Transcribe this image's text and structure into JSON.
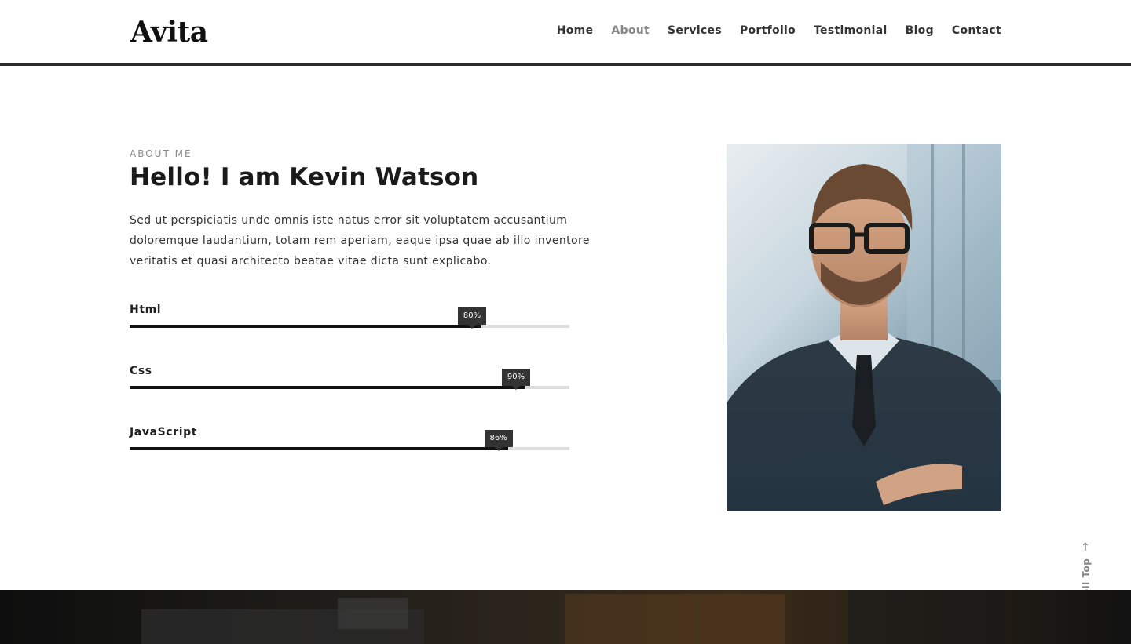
{
  "header": {
    "logo": "Avita",
    "nav": [
      {
        "label": "Home",
        "active": false
      },
      {
        "label": "About",
        "active": true
      },
      {
        "label": "Services",
        "active": false
      },
      {
        "label": "Portfolio",
        "active": false
      },
      {
        "label": "Testimonial",
        "active": false
      },
      {
        "label": "Blog",
        "active": false
      },
      {
        "label": "Contact",
        "active": false
      }
    ]
  },
  "about": {
    "eyebrow": "ABOUT ME",
    "title": "Hello! I am Kevin Watson",
    "description": "Sed ut perspiciatis unde omnis iste natus error sit voluptatem accusantium doloremque laudantium, totam rem aperiam, eaque ipsa quae ab illo inventore veritatis et quasi architecto beatae vitae dicta sunt explicabo.",
    "skills": [
      {
        "label": "Html",
        "percent": 80,
        "badge": "80%"
      },
      {
        "label": "Css",
        "percent": 90,
        "badge": "90%"
      },
      {
        "label": "JavaScript",
        "percent": 86,
        "badge": "86%"
      }
    ]
  },
  "scroll_top": {
    "label": "Scroll Top",
    "icon": "arrow-up-icon"
  },
  "colors": {
    "accent": "#111111",
    "track": "#dddddd",
    "tooltip": "#333333",
    "muted": "#888888"
  }
}
